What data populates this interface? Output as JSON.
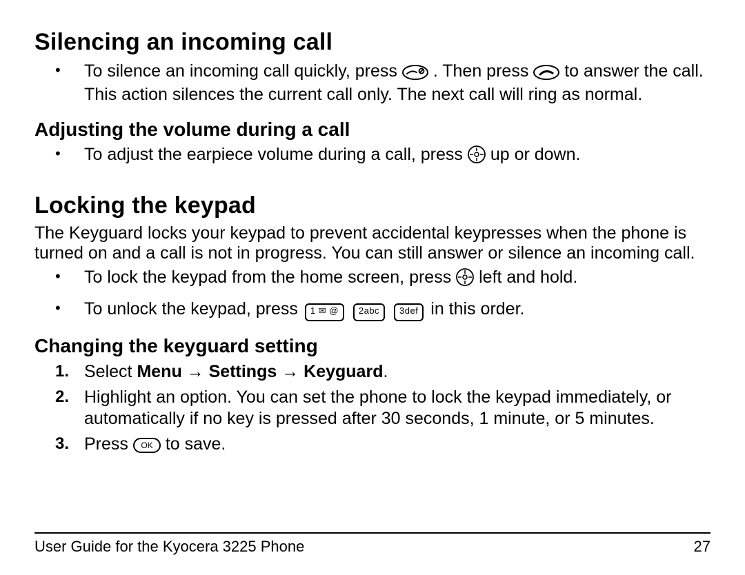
{
  "section1": {
    "heading": "Silencing an incoming call",
    "bullet1_a": "To silence an incoming call quickly, press ",
    "bullet1_b": ". Then press ",
    "bullet1_c": " to answer the call. This action silences the current call only. The next call will ring as normal."
  },
  "section2": {
    "heading": "Adjusting the volume during a call",
    "bullet1_a": "To adjust the earpiece volume during a call, press ",
    "bullet1_b": " up or down."
  },
  "section3": {
    "heading": "Locking the keypad",
    "para": "The Keyguard locks your keypad to prevent accidental keypresses when the phone is turned on and a call is not in progress. You can still answer or silence an incoming call.",
    "bullet1_a": "To lock the keypad from the home screen, press ",
    "bullet1_b": " left and hold.",
    "bullet2_a": "To unlock the keypad, press ",
    "bullet2_b": " in this order."
  },
  "keys": {
    "k1": "1 ✉ @",
    "k2": "2abc",
    "k3": "3def",
    "ok": "OK"
  },
  "section4": {
    "heading": "Changing the keyguard setting",
    "step1_a": "Select ",
    "step1_menu": "Menu",
    "step1_arrow": " → ",
    "step1_settings": "Settings",
    "step1_keyguard": "Keyguard",
    "step1_end": ".",
    "step2": "Highlight an option. You can set the phone to lock the keypad immediately, or automatically if no key is pressed after 30 seconds, 1 minute, or 5 minutes.",
    "step3_a": "Press ",
    "step3_b": " to save."
  },
  "footer": {
    "left": "User Guide for the Kyocera 3225 Phone",
    "right": "27"
  }
}
